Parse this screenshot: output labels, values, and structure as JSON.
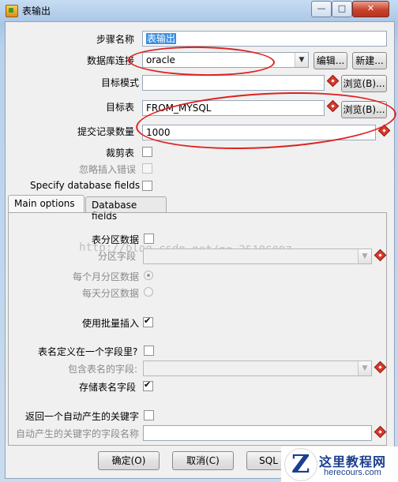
{
  "window": {
    "title": "表输出",
    "minimize": "—",
    "maximize": "□",
    "close": "✕"
  },
  "form": {
    "step_name_label": "步骤名称",
    "step_name_value": "表输出",
    "connection_label": "数据库连接",
    "connection_value": "oracle",
    "edit_button": "编辑...",
    "new_button": "新建...",
    "target_schema_label": "目标模式",
    "target_schema_value": "",
    "browse_schema_button": "浏览(B)...",
    "target_table_label": "目标表",
    "target_table_value": "FROM_MYSQL",
    "browse_table_button": "浏览(B)...",
    "commit_size_label": "提交记录数量",
    "commit_size_value": "1000",
    "truncate_label": "裁剪表",
    "ignore_errors_label": "忽略插入错误",
    "specify_fields_label": "Specify database fields"
  },
  "tabs": [
    {
      "label": "Main options",
      "active": true
    },
    {
      "label": "Database fields",
      "active": false
    }
  ],
  "main_options": {
    "partition_label": "表分区数据",
    "partition_field_label": "分区字段",
    "partition_monthly_label": "每个月分区数据",
    "partition_daily_label": "每天分区数据",
    "batch_insert_label": "使用批量插入",
    "batch_insert_checked": true,
    "table_in_field_label": "表名定义在一个字段里?",
    "table_name_field_label": "包含表名的字段:",
    "store_table_name_label": "存储表名字段",
    "store_table_name_checked": true,
    "return_key_label": "返回一个自动产生的关键字",
    "auto_key_field_label": "自动产生的关键字的字段名称"
  },
  "footer": {
    "ok_button": "确定(O)",
    "cancel_button": "取消(C)",
    "sql_button": "SQL"
  },
  "watermark": "http://blog.csdn.net/qq_25186097",
  "logo": {
    "mark": "Z",
    "title": "这里教程网",
    "url": "herecours.com"
  },
  "colors": {
    "annotation": "#e02020",
    "selection": "#3c8ee0",
    "required_marker": "#d93a2b"
  }
}
